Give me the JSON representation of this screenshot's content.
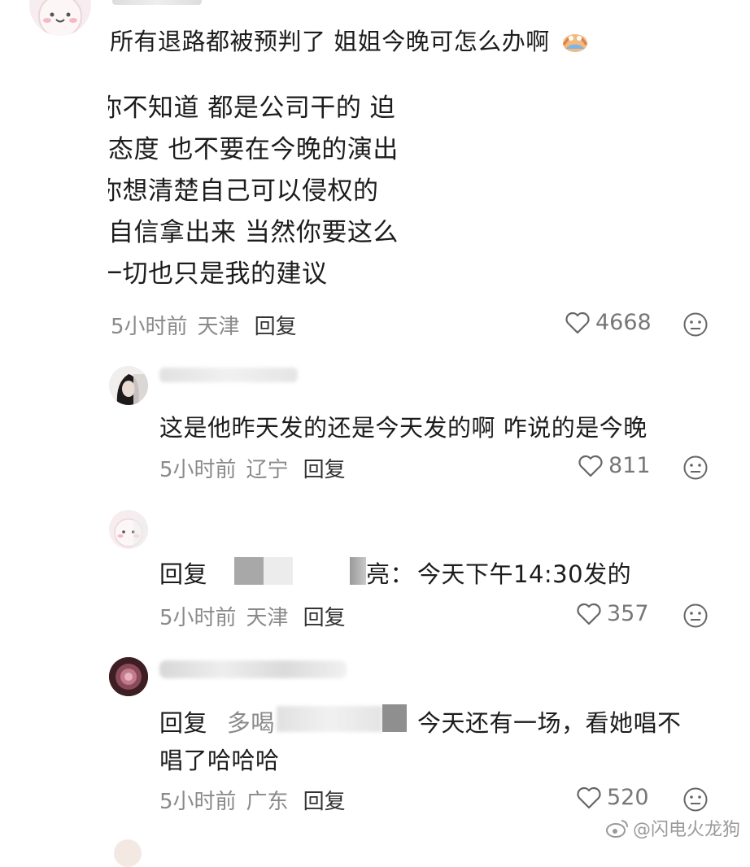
{
  "colors": {
    "meta_gray": "#8a8a8a",
    "text": "#1c1c1c",
    "reply": "#333333",
    "watermark": "#9a9a9a"
  },
  "comments": [
    {
      "text": "所有退路都被预判了 姐姐今晚可怎么办啊",
      "quote_lines": [
        "你不知道 都是公司干的 迫",
        "态度 也不要在今晚的演出",
        "你想清楚自己可以侵权的",
        "自信拿出来 当然你要这么",
        "一切也只是我的建议"
      ],
      "time": "5小时前",
      "location": "天津",
      "reply_label": "回复",
      "likes": "4668"
    },
    {
      "text": "这是他昨天发的还是今天发的啊 咋说的是今晚",
      "time": "5小时前",
      "location": "辽宁",
      "reply_label": "回复",
      "likes": "811"
    },
    {
      "reply_prefix": "回复",
      "reply_target_tail": "亮：",
      "text": "今天下午14:30发的",
      "time": "5小时前",
      "location": "天津",
      "reply_label": "回复",
      "likes": "357"
    },
    {
      "reply_prefix": "回复",
      "reply_target": "多喝",
      "text_line1": "今天还有一场，看她唱不",
      "text_line2": "唱了哈哈哈",
      "time": "5小时前",
      "location": "广东",
      "reply_label": "回复",
      "likes": "520"
    }
  ],
  "watermark": "@闪电火龙狗"
}
